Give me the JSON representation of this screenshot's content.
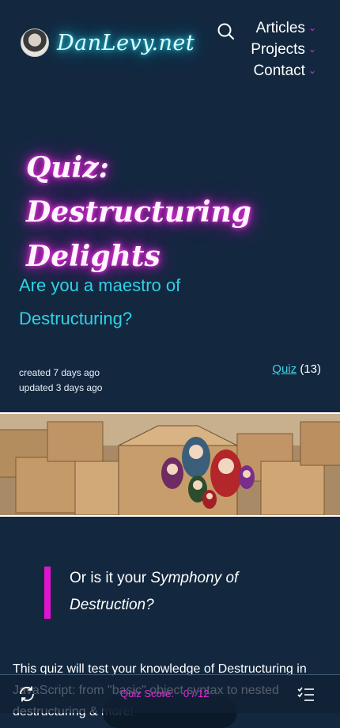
{
  "header": {
    "site_name": "DanLevy.net",
    "nav": [
      {
        "label": "Articles"
      },
      {
        "label": "Projects"
      },
      {
        "label": "Contact"
      }
    ]
  },
  "hero": {
    "title": "Quiz: Destructuring Delights",
    "subtitle": "Are you a maestro of Destructuring?"
  },
  "meta": {
    "created": "created 7 days ago",
    "updated": "updated 3 days ago",
    "tag_label": "Quiz",
    "tag_count": "(13)"
  },
  "quote": {
    "prefix": "Or is it your ",
    "emphasis": "Symphony of Destruction?"
  },
  "body": {
    "intro": "This quiz will test your knowledge of Destructuring in JavaScript: from \"basic\" object syntax to nested destructuring & more!"
  },
  "toolbar": {
    "score_label": "Quiz Score:",
    "score_value": "0 / 12"
  },
  "colors": {
    "background": "#13283f",
    "accent_magenta": "#e02ed6",
    "accent_cyan": "#2ed2e6"
  },
  "icons": [
    "avatar",
    "search-icon",
    "chevron-down-icon",
    "refresh-icon",
    "checklist-icon"
  ]
}
